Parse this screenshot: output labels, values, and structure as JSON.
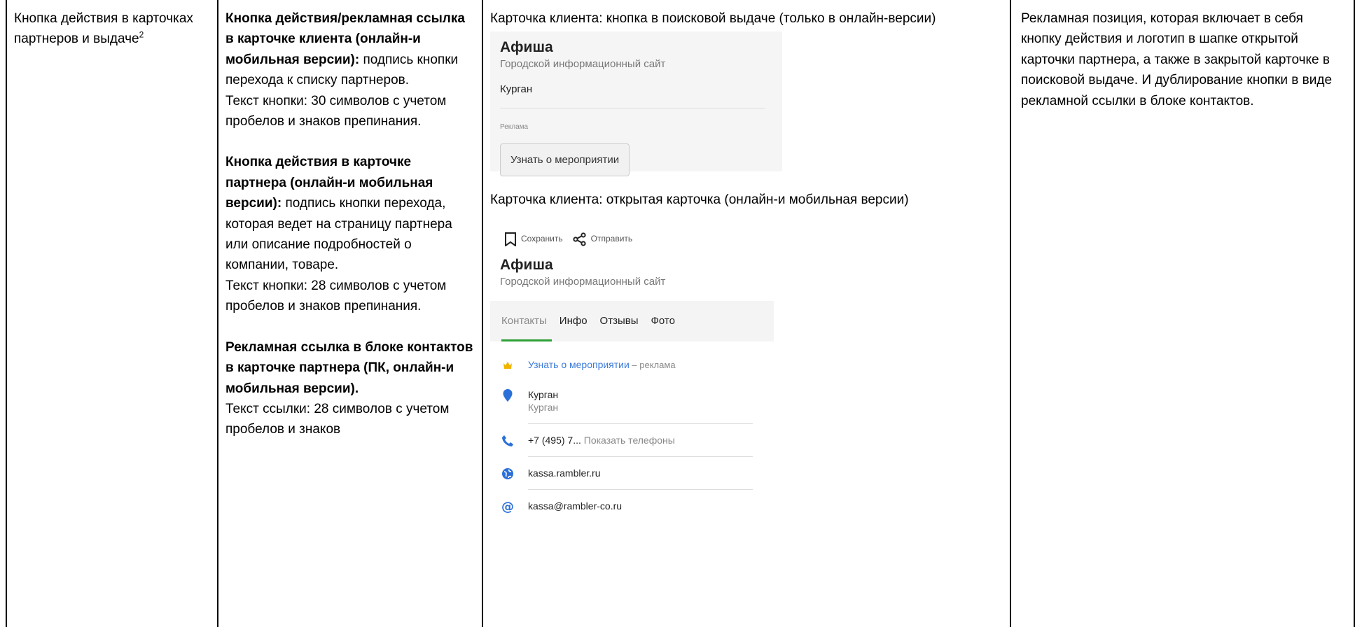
{
  "col1": {
    "text": "Кнопка действия в карточках партнеров и выдаче",
    "footnote": "2"
  },
  "col2": {
    "p1_bold": "Кнопка действия/рекламная ссылка в карточке клиента (онлайн-и мобильная версии):",
    "p1_text": " подпись кнопки перехода к списку партнеров.",
    "p1_limit": "Текст кнопки: 30 символов с учетом пробелов и знаков препинания.",
    "p2_bold": "Кнопка действия в карточке партнера (онлайн-и мобильная версии):",
    "p2_text": " подпись кнопки перехода, которая ведет на страницу партнера или описание подробностей о компании, товаре.",
    "p2_limit": "Текст кнопки: 28 символов с учетом пробелов и знаков препинания.",
    "p3_bold": "Рекламная ссылка в блоке контактов в карточке партнера (ПК, онлайн-и мобильная версии).",
    "p3_limit": "Текст ссылки: 28 символов с учетом пробелов и знаков"
  },
  "col3": {
    "caption1": "Карточка клиента: кнопка в поисковой выдаче (только в онлайн-версии)",
    "search_card": {
      "title": "Афиша",
      "subtitle": "Городской информационный сайт",
      "city": "Курган",
      "ad_label": "Реклама",
      "button": "Узнать о мероприятии"
    },
    "caption2": "Карточка клиента: открытая карточка (онлайн-и мобильная версии)",
    "open_card": {
      "save": "Сохранить",
      "send": "Отправить",
      "title": "Афиша",
      "subtitle": "Городской информационный сайт",
      "tabs": [
        "Контакты",
        "Инфо",
        "Отзывы",
        "Фото"
      ],
      "ad_link": "Узнать о мероприятии",
      "ad_suffix": " – реклама",
      "address_title": "Курган",
      "address_sub": "Курган",
      "phone": "+7 (495) 7...",
      "phone_show": " Показать телефоны",
      "site": "kassa.rambler.ru",
      "email": "kassa@rambler-co.ru"
    },
    "colors": {
      "link": "#3b7ad8",
      "tab_underline": "#2da035",
      "crown": "#f0b400"
    }
  },
  "col4": {
    "text": "Рекламная позиция, которая включает в себя кнопку действия и логотип в шапке открытой карточки партнера, а также в закрытой карточке в поисковой выдаче. И дублирование кнопки в виде рекламной ссылки в блоке контактов."
  }
}
